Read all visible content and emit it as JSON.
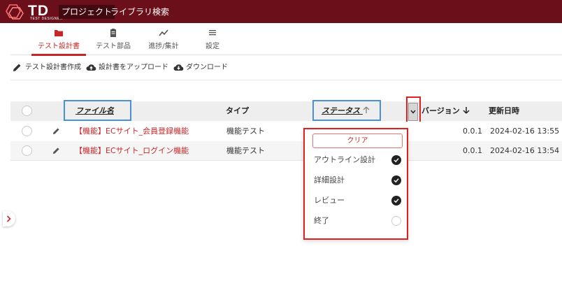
{
  "app": {
    "logo_text": "TD",
    "logo_sub": "TEST DESIGNER",
    "nav": [
      {
        "label": "プロジェクト",
        "active": true
      },
      {
        "label": "ライブラリ",
        "active": false
      },
      {
        "label": "検索",
        "active": false
      }
    ]
  },
  "tabs": [
    {
      "label": "テスト設計書",
      "icon": "folder-icon",
      "active": true
    },
    {
      "label": "テスト部品",
      "icon": "clipboard-icon",
      "active": false
    },
    {
      "label": "進捗/集計",
      "icon": "trend-icon",
      "active": false
    },
    {
      "label": "設定",
      "icon": "menu-lines-icon",
      "active": false
    }
  ],
  "actions": {
    "create_label": "テスト設計書作成",
    "upload_label": "設計書をアップロード",
    "download_label": "ダウンロード"
  },
  "table": {
    "columns": {
      "file_name": "ファイル名",
      "type": "タイプ",
      "status": "ステータス",
      "version": "バージョン",
      "updated": "更新日時"
    },
    "rows": [
      {
        "file_name": "【機能】ECサイト_会員登録機能",
        "type": "機能テスト",
        "version": "0.0.1",
        "updated": "2024-02-16 13:55"
      },
      {
        "file_name": "【機能】ECサイト_ログイン機能",
        "type": "機能テスト",
        "version": "0.0.1",
        "updated": "2024-02-16 13:54"
      }
    ]
  },
  "status_filter": {
    "clear_label": "クリア",
    "options": [
      {
        "label": "アウトライン設計",
        "checked": true
      },
      {
        "label": "詳細設計",
        "checked": true
      },
      {
        "label": "レビュー",
        "checked": true
      },
      {
        "label": "終了",
        "checked": false
      }
    ]
  },
  "colors": {
    "topbar": "#6b0f1a",
    "accent": "#c62828",
    "highlight_blue": "#4a90d9",
    "highlight_red": "#e02020"
  }
}
